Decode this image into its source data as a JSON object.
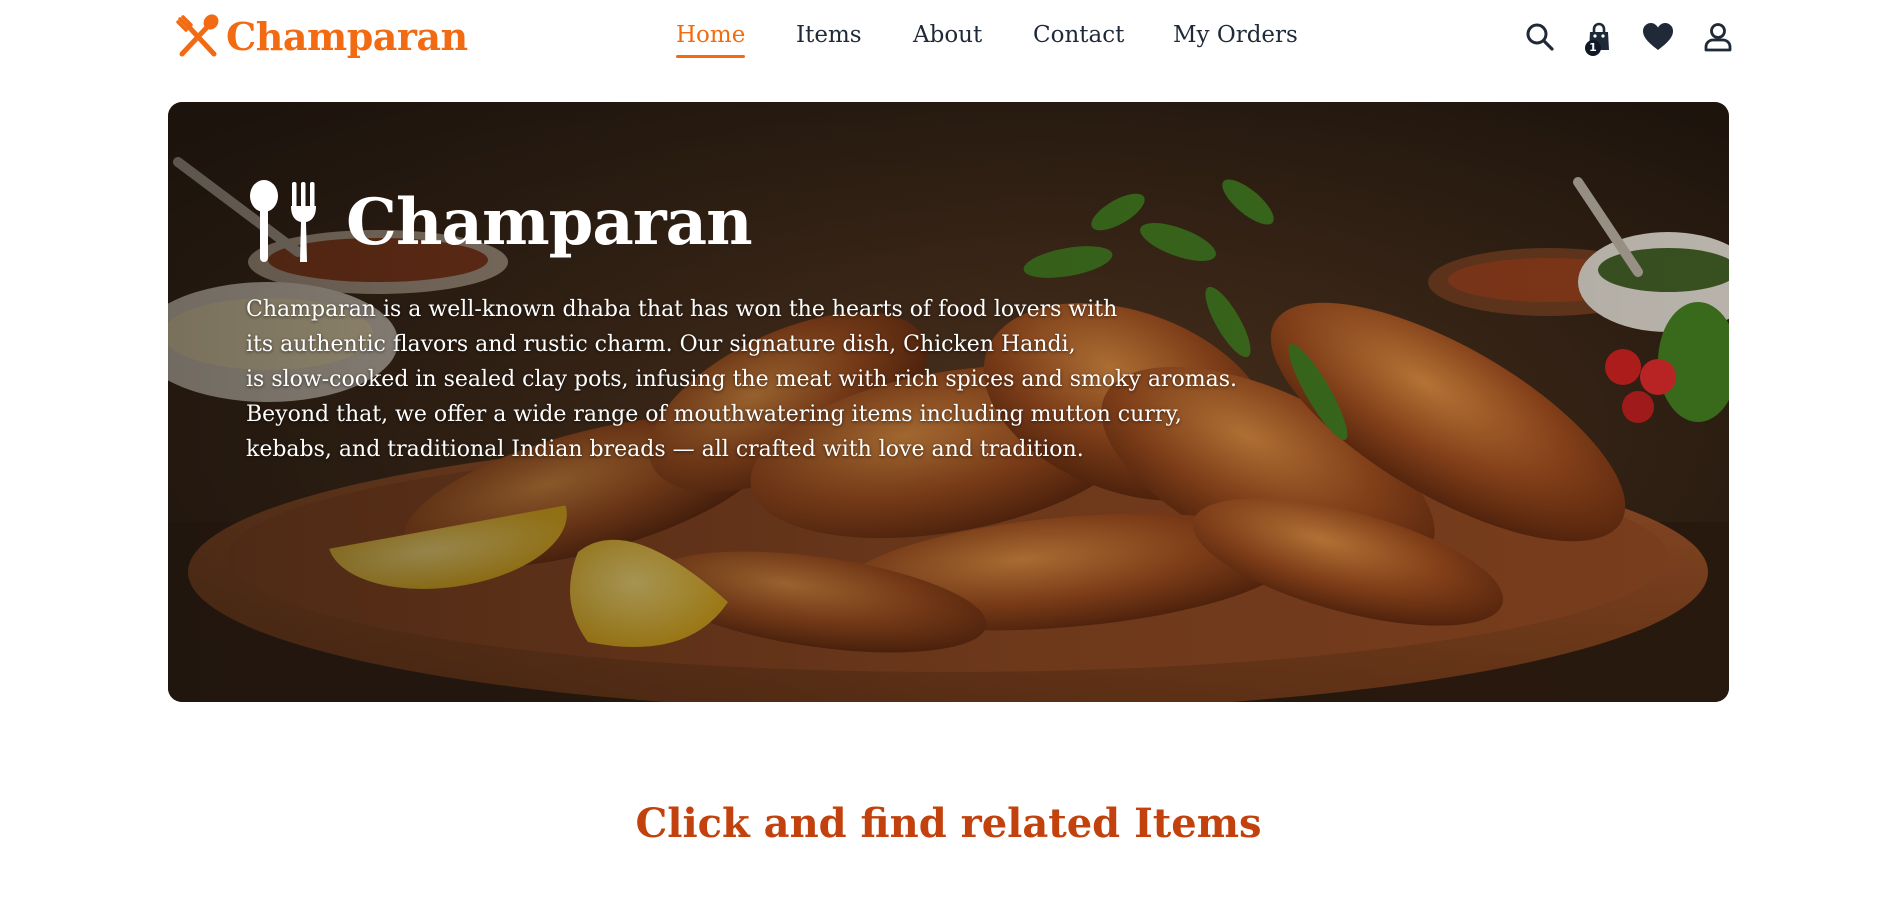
{
  "brand": {
    "name": "Champaran",
    "color": "#f26b12",
    "logo_icon": "spoon-fork-cross-icon"
  },
  "nav": {
    "items": [
      {
        "label": "Home",
        "active": true
      },
      {
        "label": "Items",
        "active": false
      },
      {
        "label": "About",
        "active": false
      },
      {
        "label": "Contact",
        "active": false
      },
      {
        "label": "My Orders",
        "active": false
      }
    ]
  },
  "header_actions": {
    "search_icon": "search-icon",
    "cart_icon": "shopping-bag-icon",
    "cart_count": "1",
    "wishlist_icon": "heart-icon",
    "account_icon": "user-icon"
  },
  "hero": {
    "title": "Champaran",
    "icon": "spoon-fork-icon",
    "background_image": "grilled chicken platter with lemon wedges",
    "description_lines": [
      "Champaran is a well-known dhaba that has won the hearts of food lovers with",
      "its authentic flavors and rustic charm. Our signature dish, Chicken Handi,",
      "is slow-cooked in sealed clay pots, infusing the meat with rich spices and smoky aromas.",
      "Beyond that, we offer a wide range of mouthwatering items including mutton curry,",
      "kebabs, and traditional Indian breads — all crafted with love and tradition."
    ]
  },
  "section": {
    "heading": "Click and find related Items",
    "heading_color": "#c2410c"
  }
}
